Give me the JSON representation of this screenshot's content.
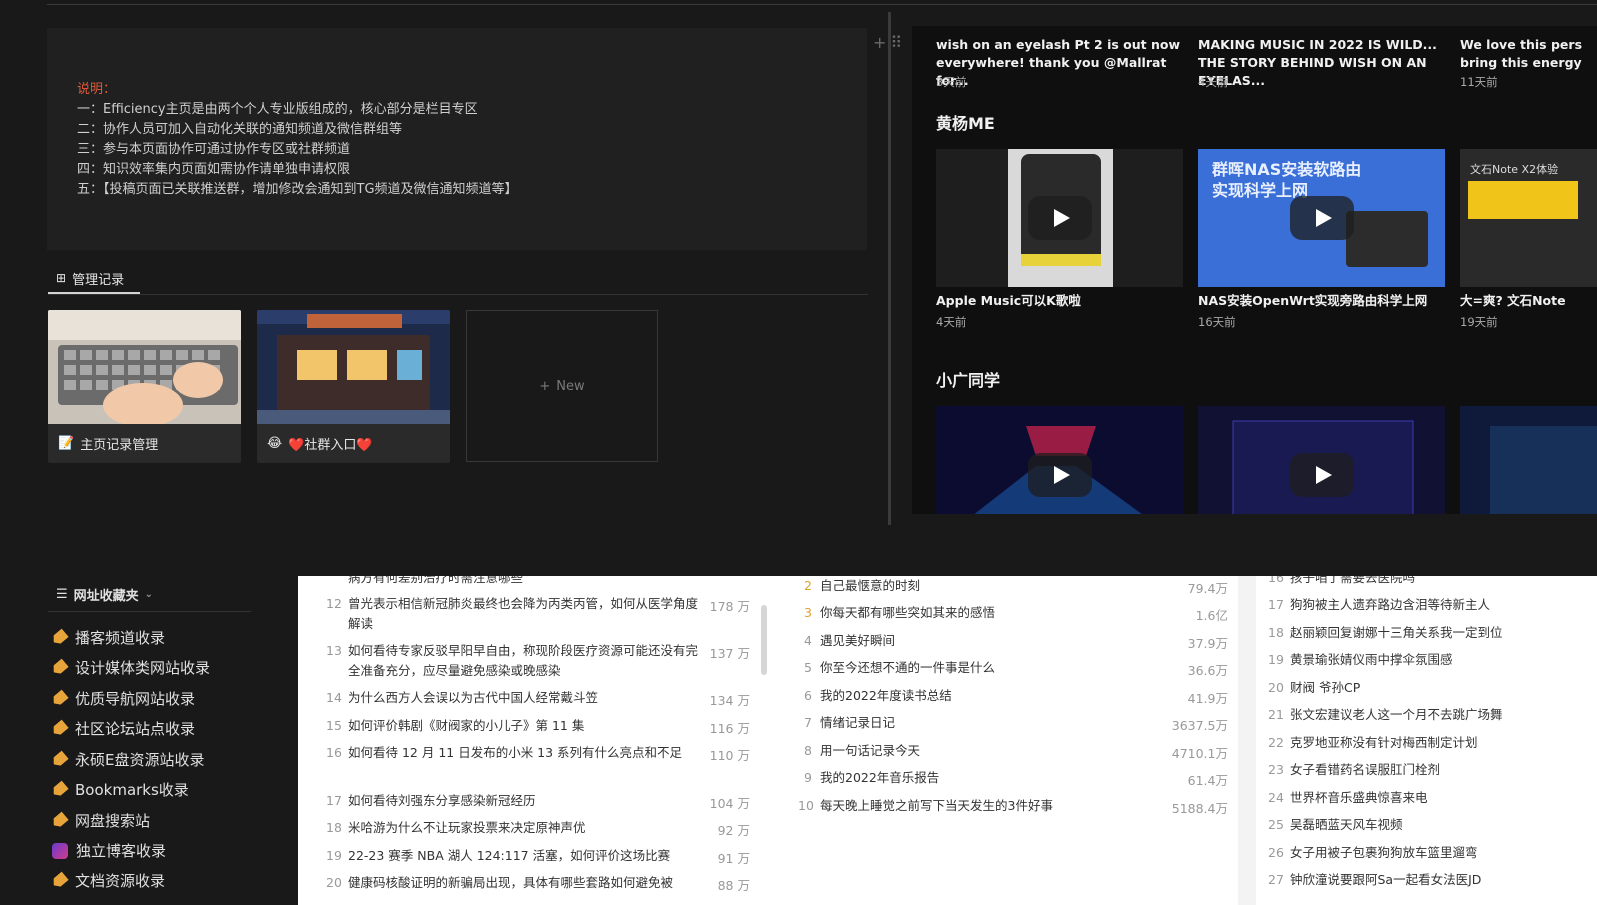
{
  "info": {
    "title": "说明：",
    "lines": [
      "一：Efficiency主页是由两个个人专业版组成的，核心部分是栏目专区",
      "二：协作人员可加入自动化关联的通知频道及微信群组等",
      "三：参与本页面协作可通过协作专区或社群频道",
      "四：知识效率集内页面如需协作请单独申请权限",
      "五：【投稿页面已关联推送群，增加修改会通知到TG频道及微信通知频道等】"
    ]
  },
  "manage": {
    "tab_label": "管理记录",
    "cards": [
      {
        "icon": "📝",
        "label": "主页记录管理"
      },
      {
        "icon": "😂",
        "label": "❤️社群入口❤️"
      }
    ],
    "new_label": "New"
  },
  "videos": {
    "top_row": [
      {
        "title": "wish on an eyelash Pt 2 is out now everywhere! thank you @Mallrat for...",
        "meta": "3天前"
      },
      {
        "title": "MAKING MUSIC IN 2022 IS WILD... THE STORY BEHIND WISH ON AN EYELAS...",
        "meta": "4天前"
      },
      {
        "title": "We love this pers bring this energy",
        "meta": "11天前"
      }
    ],
    "section1": "黄杨ME",
    "row1": [
      {
        "title": "Apple Music可以K歌啦",
        "meta": "4天前",
        "thumb_text": ""
      },
      {
        "title": "NAS安装OpenWrt实现旁路由科学上网",
        "meta": "16天前",
        "thumb_text": "群晖NAS安装软路由 实现科学上网"
      },
      {
        "title": "大=爽? 文石Note",
        "meta": "19天前",
        "thumb_text": "文石Note X2体验"
      }
    ],
    "section2": "小广同学"
  },
  "bookmarks": {
    "header": "网址收藏夹",
    "items": [
      "播客频道收录",
      "设计媒体类网站收录",
      "优质导航网站收录",
      "社区论坛站点收录",
      "永硕E盘资源站收录",
      "Bookmarks收录",
      "网盘搜索站",
      "独立博客收录",
      "文档资源收录"
    ]
  },
  "list1": [
    {
      "n": "",
      "t": "病方有何差别治疗时需注意哪些",
      "h": ""
    },
    {
      "n": "12",
      "t": "曾光表示相信新冠肺炎最终也会降为丙类丙管，如何从医学角度解读",
      "h": "178 万"
    },
    {
      "n": "13",
      "t": "如何看待专家反驳早阳早自由，称现阶段医疗资源可能还没有完全准备充分，应尽量避免感染或晚感染",
      "h": "137 万"
    },
    {
      "n": "14",
      "t": "为什么西方人会误以为古代中国人经常戴斗笠",
      "h": "134 万"
    },
    {
      "n": "15",
      "t": "如何评价韩剧《财阀家的小儿子》第 11 集",
      "h": "116 万"
    },
    {
      "n": "16",
      "t": "如何看待 12 月 11 日发布的小米 13 系列有什么亮点和不足",
      "h": "110 万"
    },
    {
      "n": "17",
      "t": "如何看待刘强东分享感染新冠经历",
      "h": "104 万"
    },
    {
      "n": "18",
      "t": "米哈游为什么不让玩家投票来决定原神声优",
      "h": "92 万"
    },
    {
      "n": "19",
      "t": "22-23 赛季 NBA 湖人 124:117 活塞，如何评价这场比赛",
      "h": "91 万"
    },
    {
      "n": "20",
      "t": "健康码核酸证明的新骗局出现，具体有哪些套路如何避免被",
      "h": "88 万"
    }
  ],
  "list2": [
    {
      "n": "2",
      "t": "自己最惬意的时刻",
      "h": "79.4万"
    },
    {
      "n": "3",
      "t": "你每天都有哪些突如其来的感悟",
      "h": "1.6亿"
    },
    {
      "n": "4",
      "t": "遇见美好瞬间",
      "h": "37.9万"
    },
    {
      "n": "5",
      "t": "你至今还想不通的一件事是什么",
      "h": "36.6万"
    },
    {
      "n": "6",
      "t": "我的2022年度读书总结",
      "h": "41.9万"
    },
    {
      "n": "7",
      "t": "情绪记录日记",
      "h": "3637.5万"
    },
    {
      "n": "8",
      "t": "用一句话记录今天",
      "h": "4710.1万"
    },
    {
      "n": "9",
      "t": "我的2022年音乐报告",
      "h": "61.4万"
    },
    {
      "n": "10",
      "t": "每天晚上睡觉之前写下当天发生的3件好事",
      "h": "5188.4万"
    }
  ],
  "list3": [
    {
      "n": "16",
      "t": "孩子咱了需要去医院吗"
    },
    {
      "n": "17",
      "t": "狗狗被主人遗弃路边含泪等待新主人"
    },
    {
      "n": "18",
      "t": "赵丽颖回复谢娜十三角关系我一定到位"
    },
    {
      "n": "19",
      "t": "黄景瑜张婧仪雨中撑伞氛围感"
    },
    {
      "n": "20",
      "t": "财阀 爷孙CP"
    },
    {
      "n": "21",
      "t": "张文宏建议老人这一个月不去跳广场舞"
    },
    {
      "n": "22",
      "t": "克罗地亚称没有针对梅西制定计划"
    },
    {
      "n": "23",
      "t": "女子看错药名误服肛门栓剂"
    },
    {
      "n": "24",
      "t": "世界杯音乐盛典惊喜来电"
    },
    {
      "n": "25",
      "t": "吴磊晒蓝天风车视频"
    },
    {
      "n": "26",
      "t": "女子用被子包裹狗狗放车篮里遛弯"
    },
    {
      "n": "27",
      "t": "钟欣潼说要跟阿Sa一起看女法医JD"
    }
  ]
}
